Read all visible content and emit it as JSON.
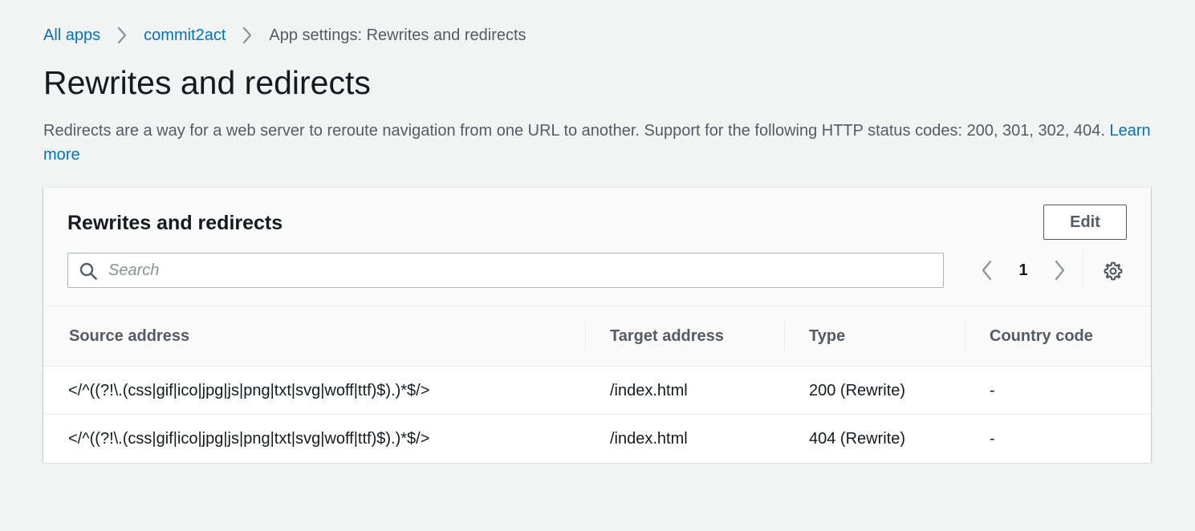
{
  "breadcrumb": {
    "items": [
      {
        "label": "All apps"
      },
      {
        "label": "commit2act"
      },
      {
        "label": "App settings: Rewrites and redirects"
      }
    ]
  },
  "page": {
    "title": "Rewrites and redirects",
    "description": "Redirects are a way for a web server to reroute navigation from one URL to another. Support for the following HTTP status codes: 200, 301, 302, 404.",
    "learn_more": "Learn more"
  },
  "panel": {
    "title": "Rewrites and redirects",
    "edit_label": "Edit",
    "search": {
      "placeholder": "Search",
      "value": ""
    },
    "pagination": {
      "current_page": "1"
    },
    "icons": {
      "search": "search-icon",
      "prev": "chevron-left-icon",
      "next": "chevron-right-icon",
      "settings": "gear-icon"
    }
  },
  "table": {
    "columns": [
      "Source address",
      "Target address",
      "Type",
      "Country code"
    ],
    "rows": [
      {
        "source": "</^((?!\\.(css|gif|ico|jpg|js|png|txt|svg|woff|ttf)$).)*$/>",
        "target": "/index.html",
        "type": "200 (Rewrite)",
        "country": "-"
      },
      {
        "source": "</^((?!\\.(css|gif|ico|jpg|js|png|txt|svg|woff|ttf)$).)*$/>",
        "target": "/index.html",
        "type": "404 (Rewrite)",
        "country": "-"
      }
    ]
  },
  "colors": {
    "background": "#f2f3f3",
    "link": "#0073bb",
    "text": "#16191f",
    "secondary_text": "#545b64",
    "border": "#eaeded"
  }
}
